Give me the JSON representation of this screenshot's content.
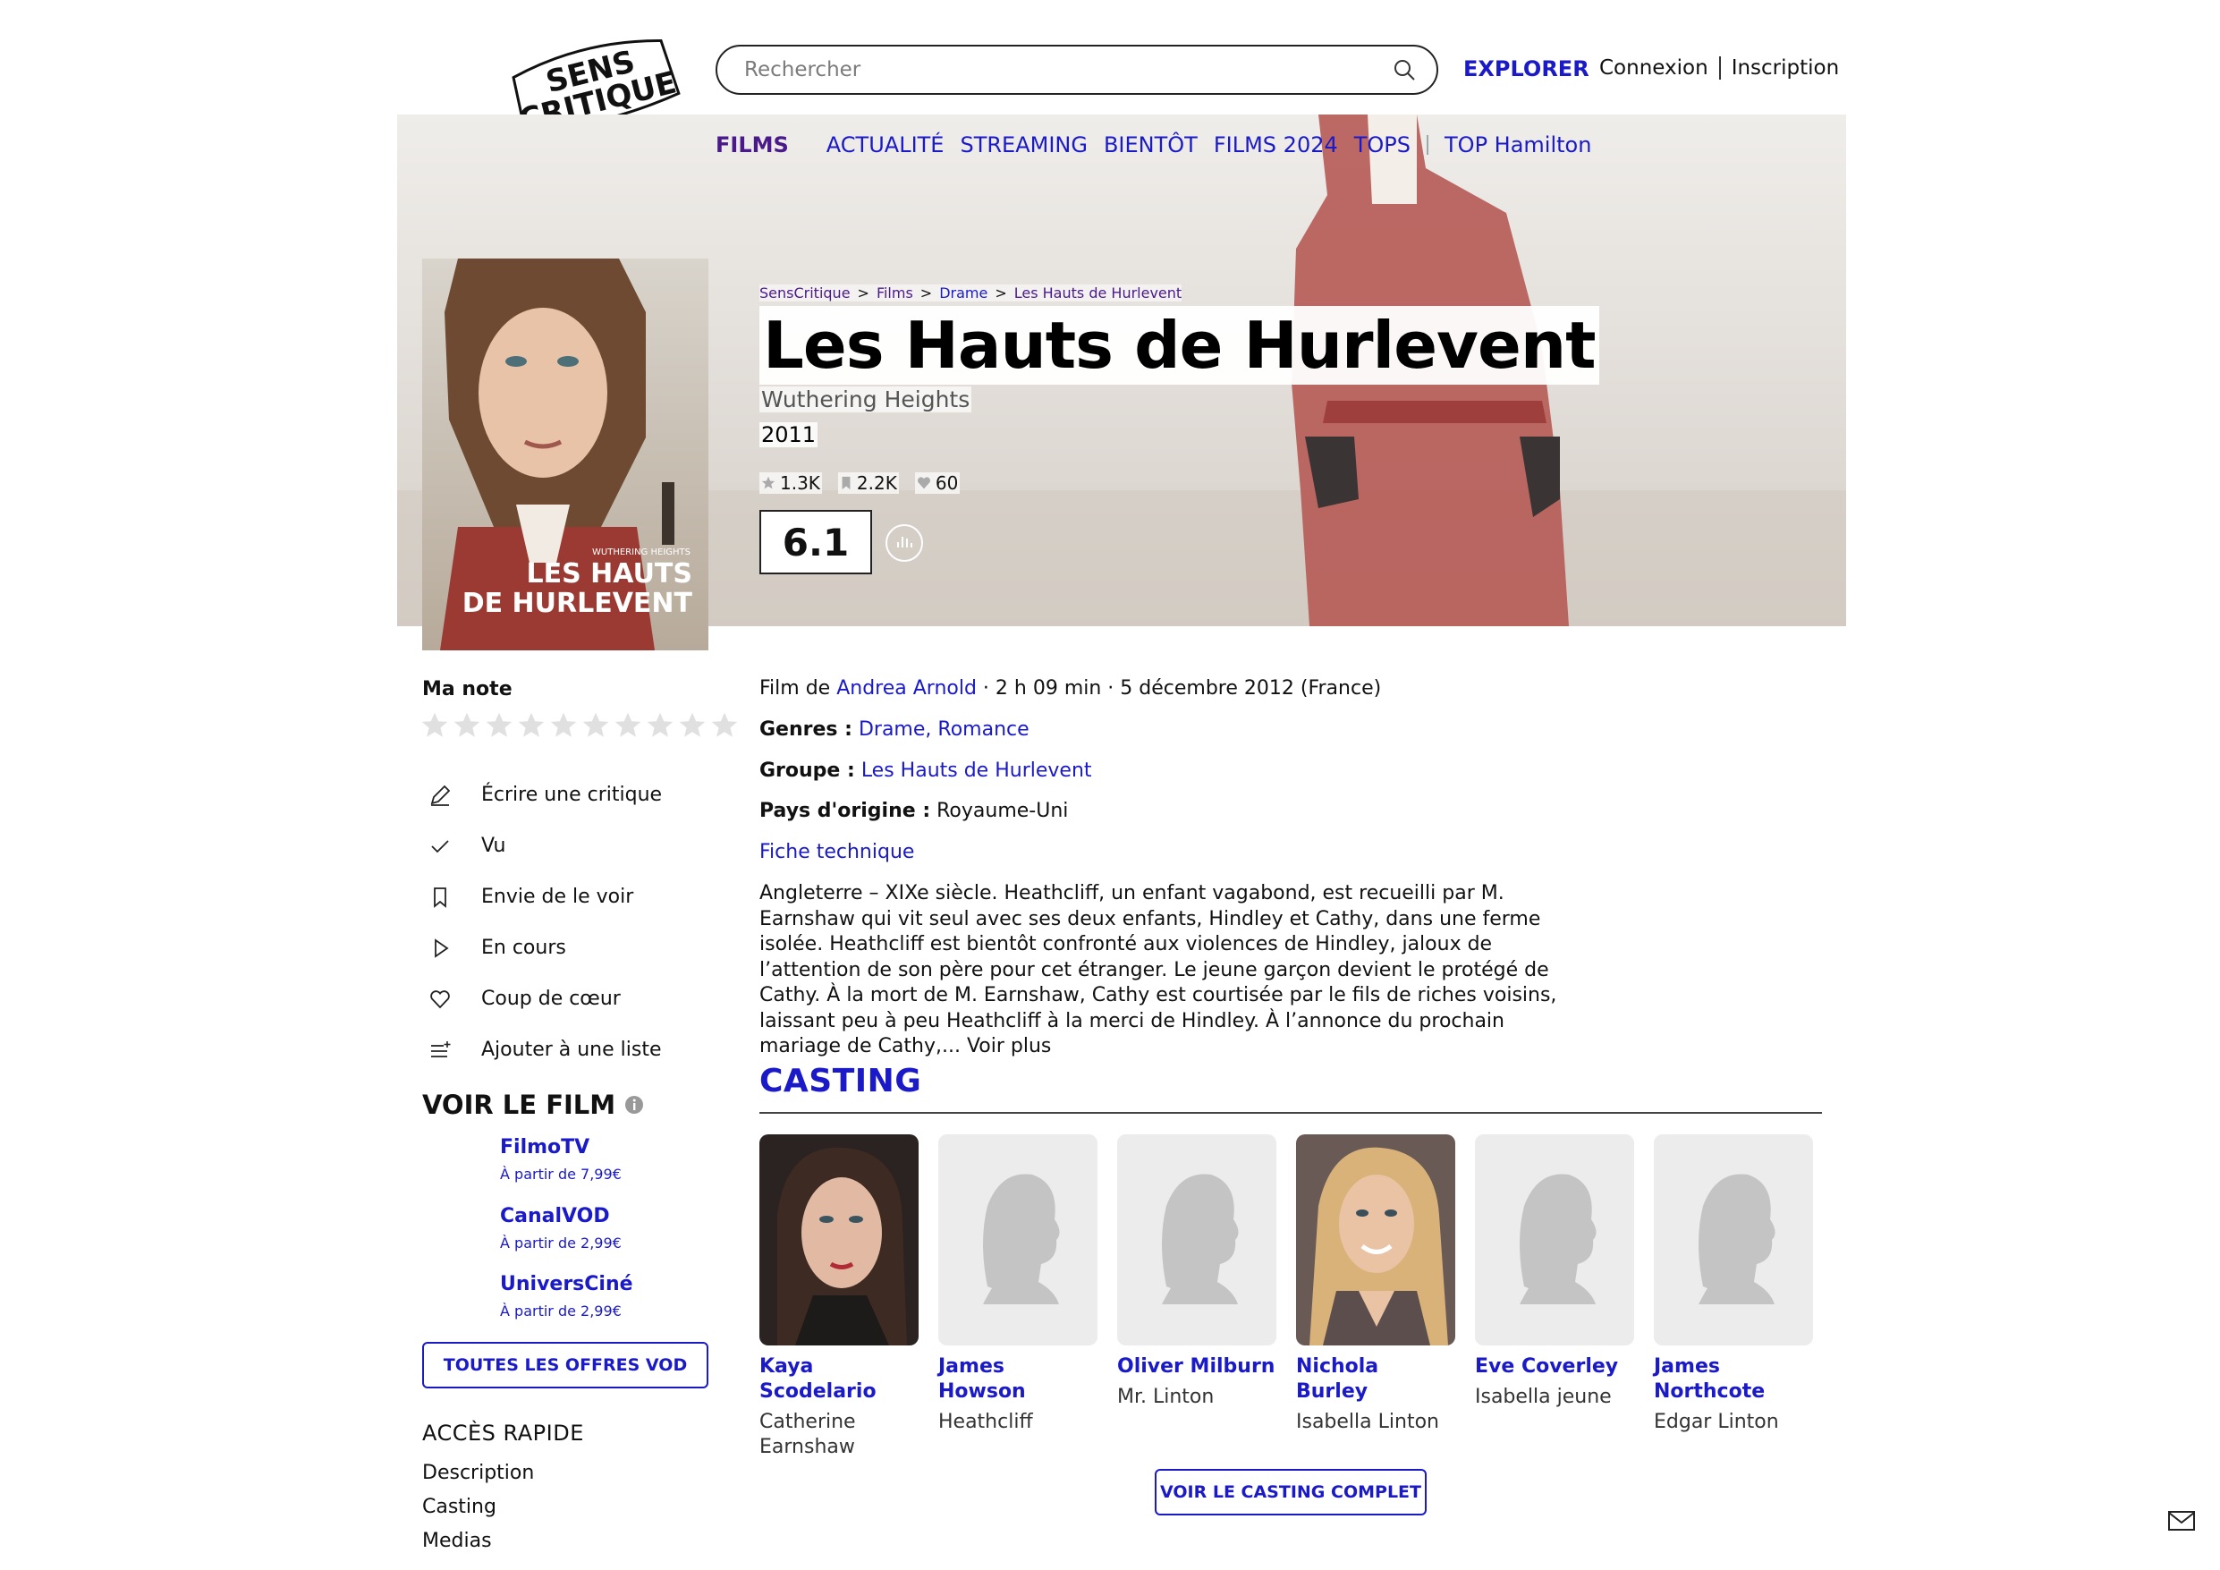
{
  "brand": {
    "logo_line1": "SENS",
    "logo_line2": "CRITIQUE"
  },
  "search": {
    "placeholder": "Rechercher"
  },
  "header": {
    "explorer": "EXPLORER",
    "login": "Connexion",
    "signup": "Inscription"
  },
  "nav": {
    "active": "FILMS",
    "items": [
      "ACTUALITÉ",
      "STREAMING",
      "BIENTÔT",
      "FILMS 2024",
      "TOPS"
    ],
    "extra": "TOP Hamilton"
  },
  "breadcrumb": [
    "SensCritique",
    ">",
    "Films",
    ">",
    "Drame",
    ">",
    "Les Hauts de Hurlevent"
  ],
  "film": {
    "title": "Les Hauts de Hurlevent",
    "original_title": "Wuthering Heights",
    "year": "2011",
    "ratings_count": "1.3K",
    "wishlist_count": "2.2K",
    "favorites_count": "60",
    "score": "6.1",
    "poster_line1": "WUTHERING HEIGHTS",
    "poster_line2": "LES HAUTS",
    "poster_line3": "DE HURLEVENT"
  },
  "my_rating": {
    "label": "Ma note",
    "star_count": 10
  },
  "actions": [
    {
      "icon": "pencil-icon",
      "label": "Écrire une critique"
    },
    {
      "icon": "check-icon",
      "label": "Vu"
    },
    {
      "icon": "bookmark-icon",
      "label": "Envie de le voir"
    },
    {
      "icon": "play-icon",
      "label": "En cours"
    },
    {
      "icon": "heart-icon",
      "label": "Coup de cœur"
    },
    {
      "icon": "add-list-icon",
      "label": "Ajouter à une liste"
    }
  ],
  "watch": {
    "heading": "VOIR LE FILM",
    "offers": [
      {
        "name": "FilmoTV",
        "price": "À partir de 7,99€"
      },
      {
        "name": "CanalVOD",
        "price": "À partir de 2,99€"
      },
      {
        "name": "UniversCiné",
        "price": "À partir de 2,99€"
      }
    ],
    "all_offers_button": "TOUTES LES OFFRES VOD"
  },
  "quick_access": {
    "heading": "ACCÈS RAPIDE",
    "items": [
      "Description",
      "Casting",
      "Medias"
    ]
  },
  "details": {
    "film_de_prefix": "Film de",
    "director": "Andrea Arnold",
    "meta": "· 2 h 09 min · 5 décembre 2012 (France)",
    "genres_label": "Genres :",
    "genre1": "Drame",
    "genre_sep": ",",
    "genre2": "Romance",
    "group_label": "Groupe :",
    "group": "Les Hauts de Hurlevent",
    "country_label": "Pays d'origine :",
    "country": "Royaume-Uni",
    "tech_sheet": "Fiche technique",
    "synopsis": "Angleterre – XIXe siècle. Heathcliff, un enfant vagabond, est recueilli par M. Earnshaw qui vit seul avec ses deux enfants, Hindley et Cathy, dans une ferme isolée. Heathcliff est bientôt confronté aux violences de Hindley, jaloux de l’attention de son père pour cet étranger. Le jeune garçon devient le protégé de Cathy. À la mort de M. Earnshaw, Cathy est courtisée par le fils de riches voisins, laissant peu à peu Heathcliff à la merci de Hindley. À l’annonce du prochain mariage de Cathy,...",
    "see_more": "Voir plus"
  },
  "casting": {
    "heading": "CASTING",
    "members": [
      {
        "name": "Kaya Scodelario",
        "role": "Catherine Earnshaw",
        "photo": "photo"
      },
      {
        "name": "James Howson",
        "role": "Heathcliff",
        "photo": "placeholder"
      },
      {
        "name": "Oliver Milburn",
        "role": "Mr. Linton",
        "photo": "placeholder"
      },
      {
        "name": "Nichola Burley",
        "role": "Isabella Linton",
        "photo": "photo"
      },
      {
        "name": "Eve Coverley",
        "role": "Isabella jeune",
        "photo": "placeholder"
      },
      {
        "name": "James Northcote",
        "role": "Edgar Linton",
        "photo": "placeholder"
      }
    ],
    "full_cast_button": "VOIR LE CASTING COMPLET"
  },
  "colors": {
    "accent": "#1a1ac8",
    "active_nav": "#4a1a8a"
  }
}
